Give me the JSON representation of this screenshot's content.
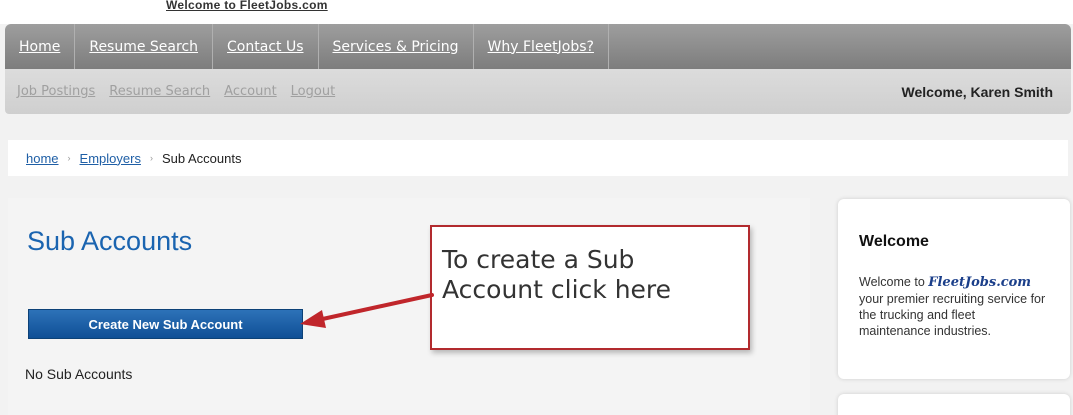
{
  "top_cut_text": "Welcome to FleetJobs.com",
  "main_nav": [
    "Home",
    "Resume Search",
    "Contact Us",
    "Services & Pricing",
    "Why FleetJobs?"
  ],
  "sub_nav": [
    "Job Postings",
    "Resume Search",
    "Account",
    "Logout"
  ],
  "welcome_user": "Welcome, Karen Smith",
  "breadcrumb": {
    "home": "home",
    "employers": "Employers",
    "current": "Sub Accounts",
    "separator": "›"
  },
  "page_title": "Sub Accounts",
  "create_button": "Create New Sub Account",
  "empty_message": "No Sub Accounts",
  "callout_text": "To create a Sub Account click here",
  "sidebar": {
    "title": "Welcome",
    "body_prefix": "Welcome to ",
    "brand": "FleetJobs.com",
    "body_suffix": " your premier recruiting service for the trucking and fleet maintenance industries."
  },
  "colors": {
    "accent": "#1a64b0",
    "button": "#1a5fa8",
    "callout_border": "#b22a2e",
    "arrow": "#c0262b"
  }
}
